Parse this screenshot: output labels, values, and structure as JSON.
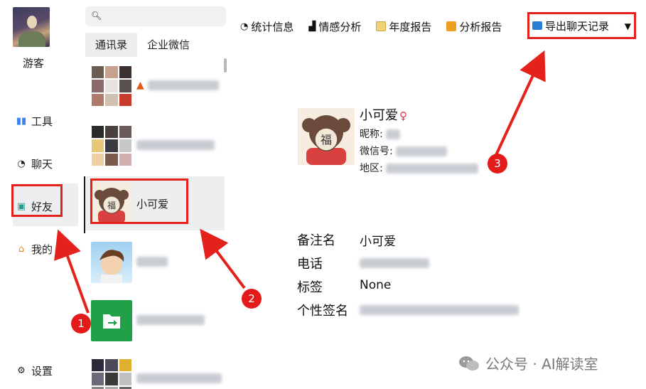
{
  "sidebar": {
    "user_name": "游客",
    "items": [
      {
        "label": "工具",
        "icon": "tools-icon"
      },
      {
        "label": "聊天",
        "icon": "chat-icon"
      },
      {
        "label": "好友",
        "icon": "contacts-icon"
      },
      {
        "label": "我的",
        "icon": "home-icon"
      }
    ],
    "settings_label": "设置"
  },
  "contacts": {
    "tabs": [
      "通讯录",
      "企业微信"
    ],
    "items": [
      {
        "name": "小可爱",
        "selected": true
      }
    ]
  },
  "toolbar": {
    "items": [
      {
        "label": "统计信息",
        "icon": "pie-chart-icon"
      },
      {
        "label": "情感分析",
        "icon": "bar-chart-icon"
      },
      {
        "label": "年度报告",
        "icon": "calendar-icon"
      },
      {
        "label": "分析报告",
        "icon": "report-icon"
      }
    ],
    "export_label": "导出聊天记录"
  },
  "profile": {
    "name": "小可爱",
    "nickname_label": "昵称:",
    "wechat_id_label": "微信号:",
    "region_label": "地区:",
    "remark_label": "备注名",
    "remark_value": "小可爱",
    "phone_label": "电话",
    "tags_label": "标签",
    "tags_value": "None",
    "signature_label": "个性签名"
  },
  "annotations": [
    "1",
    "2",
    "3"
  ],
  "watermark": "公众号 · AI解读室",
  "colors": {
    "annotation_red": "#e5211b",
    "selected_bg": "#eceef0",
    "folder_green": "#21a04a"
  }
}
